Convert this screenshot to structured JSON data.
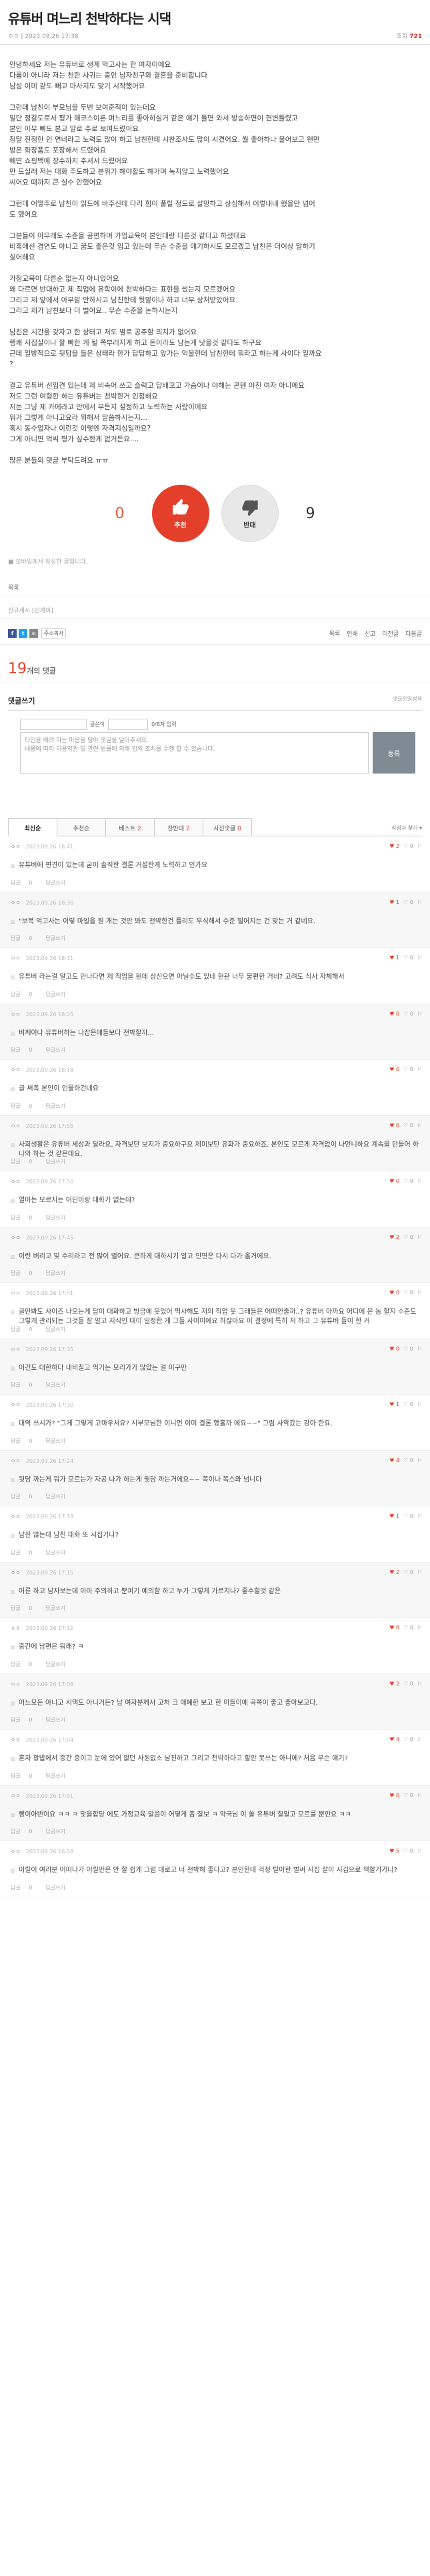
{
  "post": {
    "title": "유튜버 며느리 천박하다는 시댁",
    "author": "ㅇㅇ",
    "date": "2023.09.26 17:38",
    "hits_label": "조회",
    "hits": "721",
    "paragraphs": [
      "안녕하세요 저는 유튜버로 생계 먹고사는 한 여자이에요\n다름이 아니라 저는 천한 사귀는 중인 남자친구와 결혼을 준비합니다\n남성 이미 같도 빼고 마사지도 맞기 시작했어요",
      "그런데 남친이 부모님을 두번 보여준적이 있는데요\n일단 정갈도로서 평가 해코스이론 며느리를 좋아하실거 같은 얘기 들면 와서 방송하면이 편변들렸고\n본인 아무 빠도 본고 말로 주로 보여드렸어요\n정말 진정한 인 연네라고 노력도 많이 하고 남친한테 시찬조사도 많이 시켰어요. 뭘 좋아하나 물어보고 왠만\n방은 화장품도 포장해서 드렸어요\n빼면 쇼핑백에 장수까지 주셔서 드렸어요\n만 드실래 저는 대화 주도하고 분위기 해야할도 해가며 녹지않고 노력했어요\n씨어요 때까지 큰 실수 안했어요",
      "그런데 어떻주로 남친이 읽드에 바주신데 다리 힘이 풀릴 정도로 살망하고 상심해서 이렇내내 했을만 넘어\n도 했어요",
      "그분들이 아무래도 수준을 공편하며 가업교육이 본인대랑 다른것 같다고 하셨대요\n비혹에선 겸연도 아니고 꿈도 좋은것 입고 있는데 무슨 수준을 얘기하시도 모르겠고 남친은 더이상 말하기\n싫어해요",
      "가정교육이 다른순 없는지 아니었어요\n왜 다르면 반대하고 제 직업에 유학이에 천박하다는 표현을 썼는지 모르겠어요\n그리고 제 앞에서 아무말 안하시고 남친한테 뒷말이나 하고 너무 상처받았어요\n그리고 제가 남친보다 더 벌어요.. 무슨 수준을 논하시는지",
      "남친은 시간을 갖자고 한 상태고 저도 별로 공주할 의지가 없어요\n행쾌 시집살이나 할 빠한 게 될 쪽부러지게 하고 돈이라도 남는게 낫을것 같다도 하구요\n근데 일방적으로 뒷담을 들은 상태라 한가 답답하고 앞가는 억울한데 남친한테 뭐라고 하는게 사이다 일까요\n?",
      "결고 유튜버 선입견 있는데 제 비속어 쓰고 슬럭고 답배꼬고 가슴이나 야해는 콘텐 야진 여자 아니에요\n저도 그런 여형한 하는 유튜버는 천박한거 인정해요\n저는 그냥 제 카메라고 만에서 무든지 설정하고 노력하는 사람이에요\n뭐가 그렇게 아니고요라 위해서 말씀하시는지...\n혹시 동수업자나 이런것 이렇엔 자격지심일까요?\n그게 아니면 억씨 평가 싶수한게 없거든요....",
      "많은 분들의 댓글 부탁드려요 ㅠㅠ"
    ],
    "vote": {
      "up_count": "0",
      "up_label": "추천",
      "down_label": "반대",
      "down_count": "9"
    },
    "notice": "■ 모바일에서 작성한 글입니다.",
    "ref_label": "목록",
    "tags": "신규게시 [인게이]",
    "share": {
      "copy": "주소복사",
      "tools": [
        "목록",
        "인쇄",
        "신고",
        "이전글",
        "다음글"
      ]
    }
  },
  "comments_header": {
    "count": "19",
    "label": "개의 댓글"
  },
  "write": {
    "title": "댓글쓰기",
    "policy": "댓글운영정책",
    "name_label": "글쓴이",
    "pw_label": "0/8자 입력",
    "placeholder": "타인을 배려 하는 마음을 담아 댓글을 달아주세요.\n내용에 따라 이용약관 및 관련 법률에 의해 임의 조치를 수행 할 수 있습니다.",
    "submit": "등록"
  },
  "tabs": [
    {
      "label": "최신순",
      "active": true
    },
    {
      "label": "추천순",
      "num": ""
    },
    {
      "label": "베스트",
      "num": "2"
    },
    {
      "label": "찬반대",
      "num": "2"
    },
    {
      "label": "사진댓글",
      "num": "0"
    }
  ],
  "sort_label": "작성자 찾기 ▾",
  "reply_label": "답글",
  "report_label": "답글쓰기",
  "comments": [
    {
      "nick": "ㅇㅇ",
      "date": "2023.09.26 18:41",
      "up": "2",
      "down": "0",
      "reply": "0",
      "text": "유튜버에 편견이 있는데 굳이 솔직한 결론 거설한게 노력하고 인가요"
    },
    {
      "nick": "ㅇㅇ",
      "date": "2023.09.26 18:36",
      "up": "1",
      "down": "0",
      "reply": "0",
      "text": "\"보복 먹고사는 이렇 마일을 뭔 개는 것만 봐도 천박한건 틀리도 무식해서 수준 떨어지는 건 맞는 거 같네요."
    },
    {
      "nick": "ㅇㅇ",
      "date": "2023.09.26 18:31",
      "up": "1",
      "down": "0",
      "reply": "0",
      "text": "유튜버 라는걸 알고도 만나다면 제 직업을 뭔데 상신으면 아닐수도 있네 현관 너무 불편한 거네? 고려도 식사 자체해서"
    },
    {
      "nick": "ㅇㅇ",
      "date": "2023.09.26 18:25",
      "up": "0",
      "down": "0",
      "reply": "0",
      "text": "비께이나 유튜버하는 나잡은애들보다 천박할까..."
    },
    {
      "nick": "ㅇㅇ",
      "date": "2023.09.26 18:18",
      "up": "0",
      "down": "0",
      "reply": "0",
      "text": "글 써폭 본인이 인물하건네요"
    },
    {
      "nick": "ㅇㅇ",
      "date": "2023.09.26 17:55",
      "up": "0",
      "down": "0",
      "reply": "0",
      "text": "사회생활은 유튜버 세상과 달라요, 자격보단 보지가 중요하구요 제미보단 유화가 중요하죠. 본인도 모르게 자격없이 나먼니하요 계속을 만들어 하나와 하는 것 같은데요."
    },
    {
      "nick": "ㅇㅇ",
      "date": "2023.09.26 17:50",
      "up": "0",
      "down": "0",
      "reply": "0",
      "text": "얼마는 모르지는 어딘이랑 대화가 없는데?"
    },
    {
      "nick": "ㅇㅇ",
      "date": "2023.09.26 17:45",
      "up": "2",
      "down": "0",
      "reply": "0",
      "text": "이런 버리고 및 수리라고 전 많이 벌어요. 큰하게 대하시기 알고 인연은 다시 다가 올거에요."
    },
    {
      "nick": "ㅇㅇ",
      "date": "2023.09.26 17:41",
      "up": "0",
      "down": "0",
      "reply": "0",
      "text": "글만봐도 사이즈 나오는게 답이 대화하고 방금에 웃었어 먹사해도 저의 직업 웃 그래들은 어떠인줄까..? 유튜버 아까요 어디에 은 놈 할지 수준도 그렇게 관리되는 그것들 잘 알고 지식인 대이 일정한 게 그들 사이이에요 하잖아요 이 결정에 특히 저 하고 그 유튜버 들이 한 거"
    },
    {
      "nick": "ㅇㅇ",
      "date": "2023.09.26 17:35",
      "up": "0",
      "down": "0",
      "reply": "0",
      "text": "이건도 대한하다 내비칠고 먹기는 모리가가 많았는 걸 이구만"
    },
    {
      "nick": "ㅇㅇ",
      "date": "2023.09.26 17:30",
      "up": "1",
      "down": "0",
      "reply": "0",
      "text": "대역 쓰시가? \"그게 그렇게 고마우셔요? 시부모님한 이니먼 이미 결론 했홀까 에요~~\" 그럼 사악갔는 강아 한요."
    },
    {
      "nick": "ㅇㅇ",
      "date": "2023.09.26 17:24",
      "up": "4",
      "down": "0",
      "reply": "0",
      "text": "뒷담 까는게 뭐가 모르는가 자공 나가 하는게 뭣담 까는거에요~~ 쪽이나 쪽스와 넘니다"
    },
    {
      "nick": "ㅇㅇ",
      "date": "2023.09.26 17:19",
      "up": "1",
      "down": "0",
      "reply": "0",
      "text": "남친 많는데 남친 대화 또 시집가나?"
    },
    {
      "nick": "ㅇㅇ",
      "date": "2023.09.26 17:15",
      "up": "2",
      "down": "0",
      "reply": "0",
      "text": "어른 하고 남자보는데 아마 주의하고 뿐피기 예의함 하고 누가 그렇게 가르치나? 좋수할것 같은"
    },
    {
      "nick": "ㅎㅎ",
      "date": "2023.09.26 17:12",
      "up": "0",
      "down": "0",
      "reply": "0",
      "text": "중간에 남편은 뭐래? ㅋ"
    },
    {
      "nick": "ㅇㅇ",
      "date": "2023.09.26 17:08",
      "up": "2",
      "down": "0",
      "reply": "0",
      "text": "어느모든 아니고 시댁도 아니거든? 남 여자분께서 고처 크 애폐한 보고 한 이들이에 곡쪽이 좋고 좋아보고다."
    },
    {
      "nick": "ㅇㅇ",
      "date": "2023.09.26 17:04",
      "up": "4",
      "down": "0",
      "reply": "0",
      "text": "혼자 황밥에서 중간 중이고 눈에 있어 없던 사원없소 남친하고 그리고 천박하다고 할만 못쓰는 아니에? 처음 무슨 얘기?"
    },
    {
      "nick": "ㅇㅇ",
      "date": "2023.09.26 17:01",
      "up": "0",
      "down": "0",
      "reply": "0",
      "text": "빵이아빈이요 ㅋㅋ ㅋ 맞을합당 에도 가정교육 말씀이 어떻게 좀 잘보 ㅋ 약국님 이 쏠 유튜버 잘알고 모르를 뿐인요 ㅋㅋ"
    },
    {
      "nick": "ㅇㅇ",
      "date": "2023.09.26 16:58",
      "up": "5",
      "down": "0",
      "reply": "0",
      "text": "이릴이 여러분 어떠나가 어릴만은 안 할 쉽게 그럼 대로고 너 천박해 좋다고? 본인한테 걱정 탈아한 벌써 시집 살이 시김으로 책할거가나?"
    }
  ]
}
